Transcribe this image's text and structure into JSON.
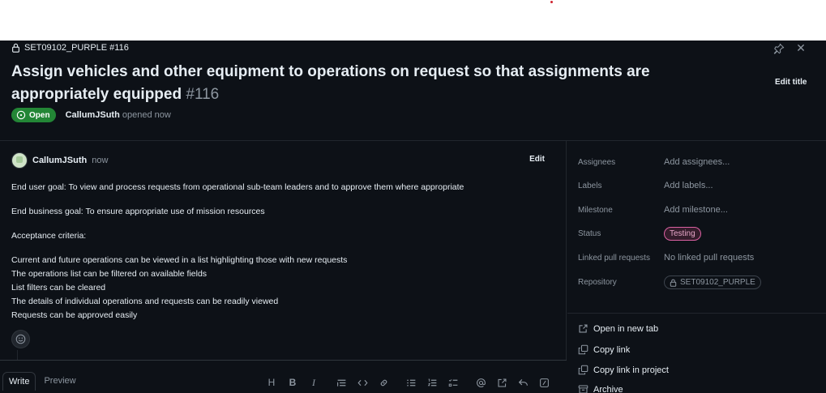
{
  "header": {
    "repo_ref": "SET09102_PURPLE #116",
    "title": "Assign vehicles and other equipment to operations on request so that assignments are appropriately equipped",
    "number": "#116",
    "edit_title_label": "Edit title",
    "state": "Open",
    "author": "CallumJSuth",
    "opened_text": "opened now"
  },
  "comment": {
    "author": "CallumJSuth",
    "time": "now",
    "edit_label": "Edit",
    "paragraphs": [
      "End user goal: To view and process requests from operational sub-team leaders and to approve them where appropriate",
      "End business goal: To ensure appropriate use of mission resources",
      "Acceptance criteria:"
    ],
    "criteria": [
      "Current and future operations can be viewed in a list highlighting those with new requests",
      "The operations list can be filtered on available fields",
      "List filters can be cleared",
      "The details of individual operations and requests can be readily viewed",
      "Requests can be approved easily"
    ]
  },
  "editor": {
    "tab_write": "Write",
    "tab_preview": "Preview"
  },
  "sidebar": {
    "assignees_label": "Assignees",
    "assignees_value": "Add assignees...",
    "labels_label": "Labels",
    "labels_value": "Add labels...",
    "milestone_label": "Milestone",
    "milestone_value": "Add milestone...",
    "status_label": "Status",
    "status_value": "Testing",
    "linked_label": "Linked pull requests",
    "linked_value": "No linked pull requests",
    "repository_label": "Repository",
    "repository_value": "SET09102_PURPLE"
  },
  "actions": {
    "open_new_tab": "Open in new tab",
    "copy_link": "Copy link",
    "copy_link_project": "Copy link in project",
    "archive": "Archive"
  },
  "colors": {
    "background": "#0d1117",
    "open_badge": "#238636",
    "status_pill": "#db61a2"
  }
}
